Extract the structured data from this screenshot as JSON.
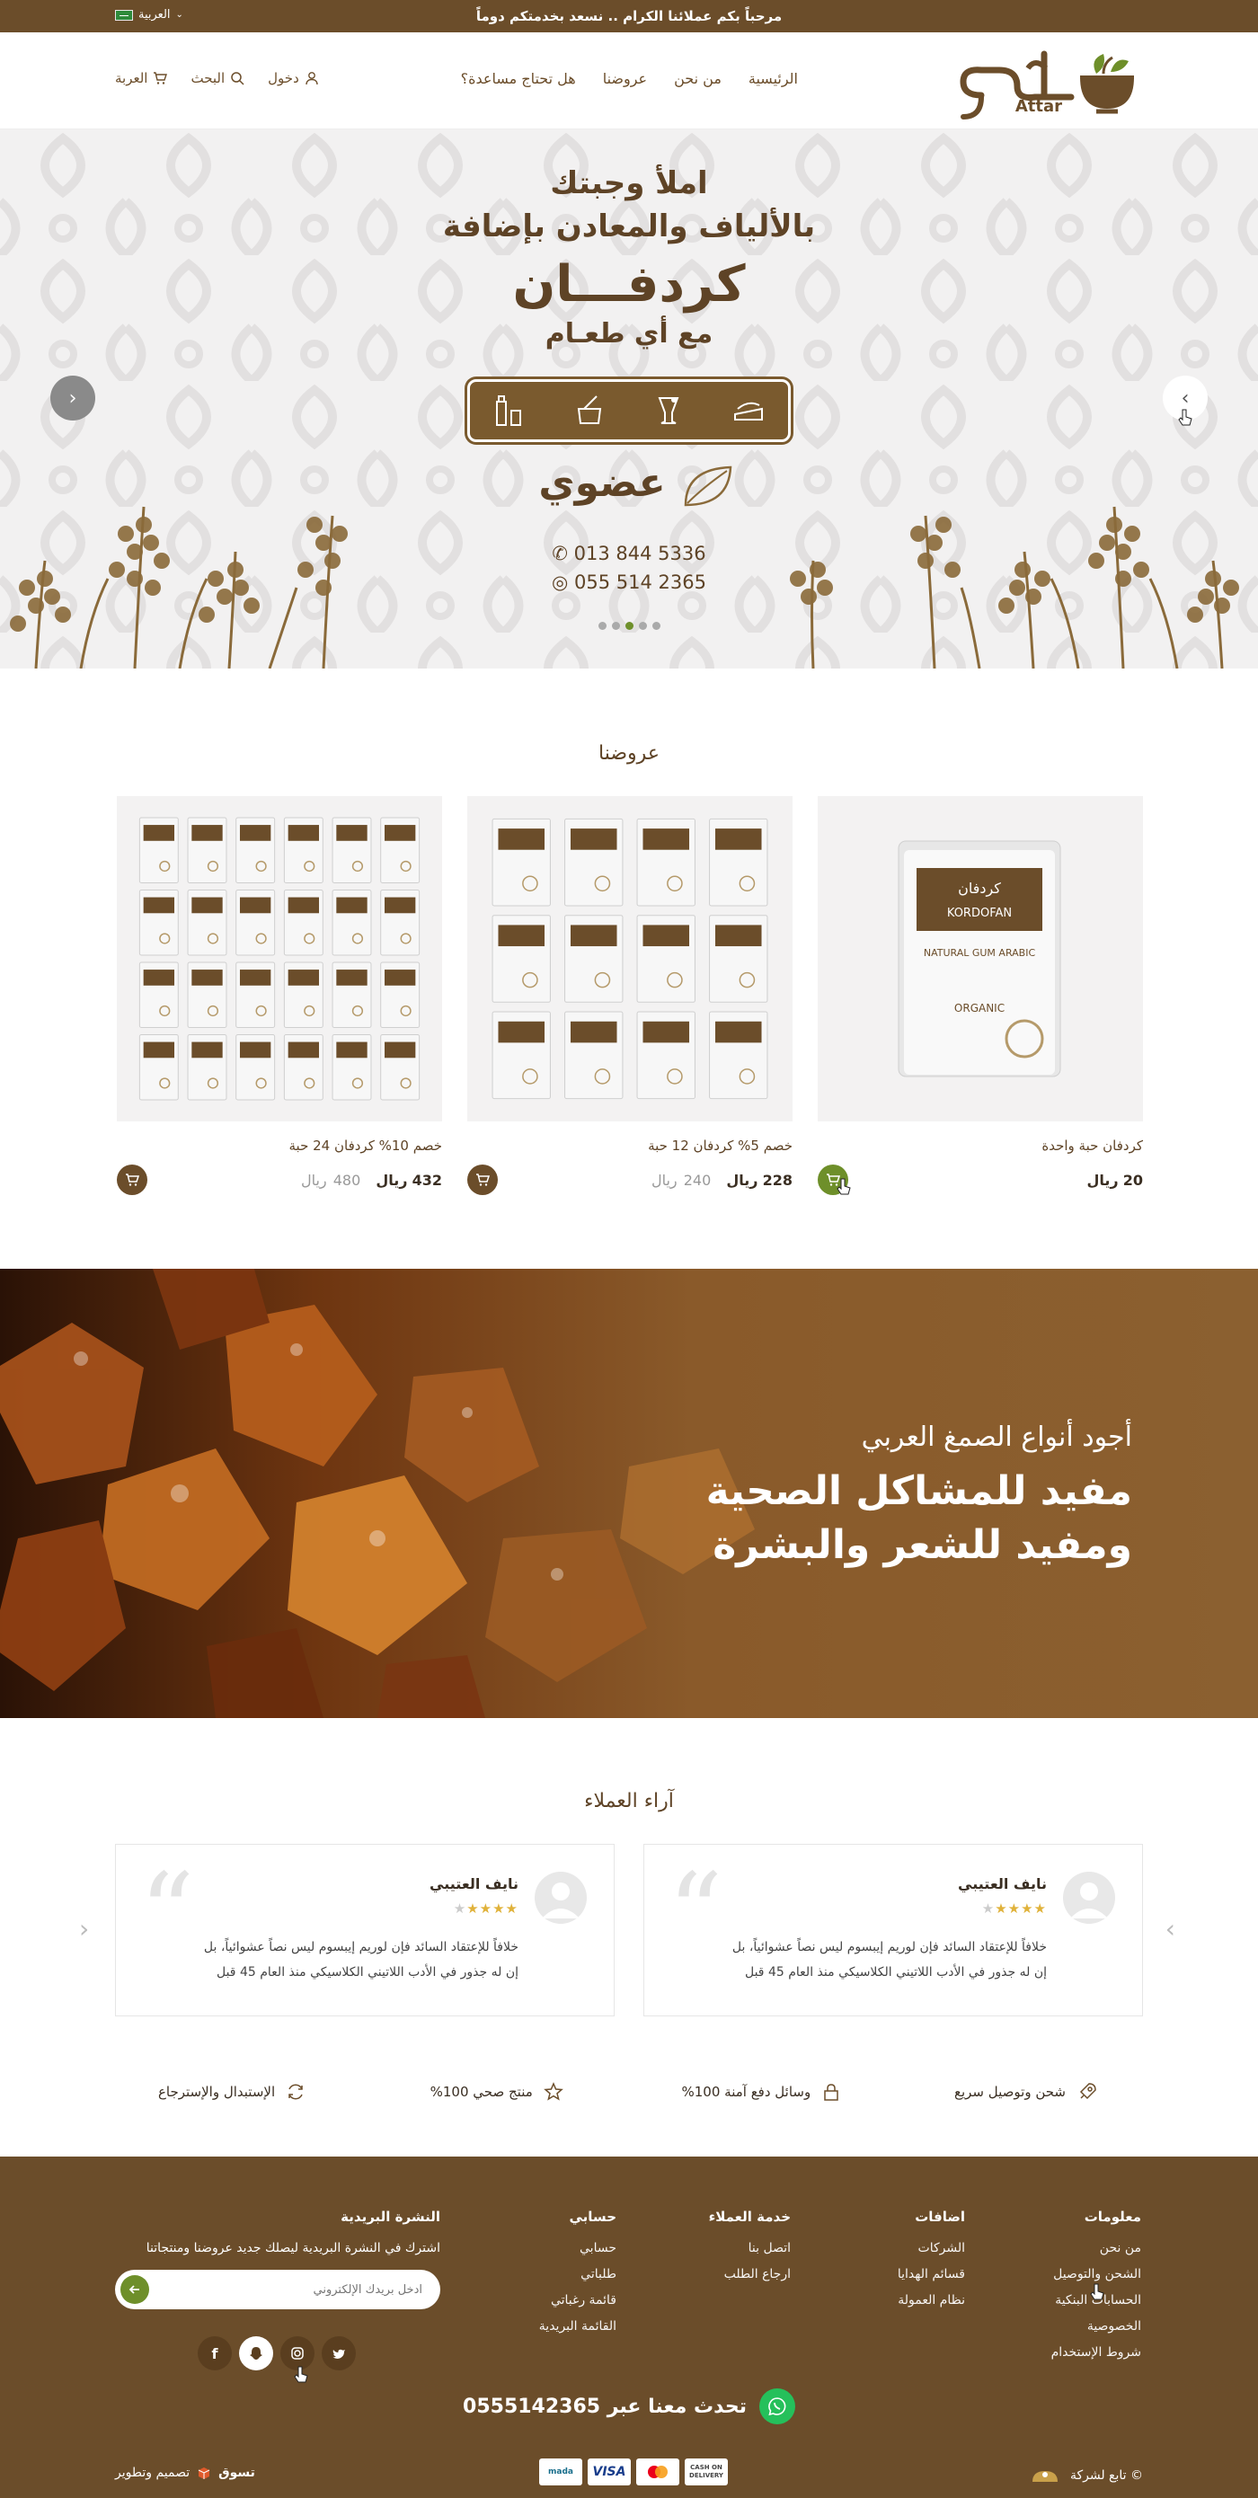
{
  "topbar": {
    "message": "مرحباً بكم عملائنا الكرام .. نسعد بخدمتكم دوماً",
    "language": "العربية"
  },
  "header": {
    "logo_text": "Attar",
    "nav": [
      "الرئيسية",
      "من نحن",
      "عروضنا",
      "هل تحتاج مساعدة؟"
    ],
    "login": "دخول",
    "search": "البحث",
    "lang": "العربة"
  },
  "hero": {
    "line1": "املأ وجبتك",
    "line2": "بالألياف والمعادن بإضافة",
    "line3": "كردفـــان",
    "line4": "مع أي طعـام",
    "brand": "عضوي",
    "phone": "013 844 5336",
    "whatsapp": "055 514 2365",
    "dots": 5,
    "active_dot": 3
  },
  "offers": {
    "title": "عروضنا",
    "products": [
      {
        "name": "كردفان حبة واحدة",
        "price": "20",
        "currency": "ريال",
        "old_price": "",
        "grid": 1,
        "cart": "green"
      },
      {
        "name": "خصم 5% كردفان 12 حبة",
        "price": "228",
        "currency": "ريال",
        "old_price": "240",
        "grid": 12,
        "cart": "brown"
      },
      {
        "name": "خصم 10% كردفان 24 حبة",
        "price": "432",
        "currency": "ريال",
        "old_price": "480",
        "grid": 24,
        "cart": "brown"
      }
    ]
  },
  "banner": {
    "line1": "أجود أنواع الصمغ العربي",
    "line2": "مفيد للمشاكل الصحية",
    "line3": "ومفيد للشعر والبشرة"
  },
  "testimonials": {
    "title": "آراء العملاء",
    "items": [
      {
        "name": "نايف العتيبي",
        "stars": 4,
        "text": "خلافاً للإعتقاد السائد فإن لوريم إيبسوم ليس نصاً عشوائياً، بل إن له جذور في الأدب اللاتيني الكلاسيكي منذ العام 45 قبل"
      },
      {
        "name": "نايف العتيبي",
        "stars": 4,
        "text": "خلافاً للإعتقاد السائد فإن لوريم إيبسوم ليس نصاً عشوائياً، بل إن له جذور في الأدب اللاتيني الكلاسيكي منذ العام 45 قبل"
      }
    ]
  },
  "features": [
    "شحن وتوصيل سريع",
    "وسائل دفع آمنة 100%",
    "منتج صحي 100%",
    "الإستبدال والإسترجاع"
  ],
  "footer": {
    "columns": [
      {
        "title": "معلومات",
        "links": [
          "من نحن",
          "الشحن والتوصيل",
          "الحسابات البنكية",
          "الخصوصية",
          "شروط الإستخدام"
        ]
      },
      {
        "title": "اضافات",
        "links": [
          "الشركات",
          "قسائم الهدايا",
          "نظام العمولة"
        ]
      },
      {
        "title": "خدمة العملاء",
        "links": [
          "اتصل بنا",
          "ارجاع الطلب"
        ]
      },
      {
        "title": "حسابي",
        "links": [
          "حسابي",
          "طلباتي",
          "قائمة رغباتي",
          "القائمة البريدية"
        ]
      }
    ],
    "newsletter": {
      "title": "النشرة البريدية",
      "desc": "اشترك في النشرة البريدية ليصلك جديد عروضنا ومنتجاتنا",
      "placeholder": "ادخل بريدك الإلكتروني"
    },
    "whatsapp": "تحدث معنا عبر 0555142365",
    "copyright": "© تابع لشركة",
    "credit": "تصميم وتطوير",
    "credit_brand": "تسوق",
    "payments": [
      "CASH ON DELIVERY",
      "mastercard",
      "VISA",
      "mada"
    ]
  },
  "colors": {
    "brand": "#6b4d2a",
    "accent": "#6e8f2a",
    "whatsapp": "#25c05b"
  }
}
